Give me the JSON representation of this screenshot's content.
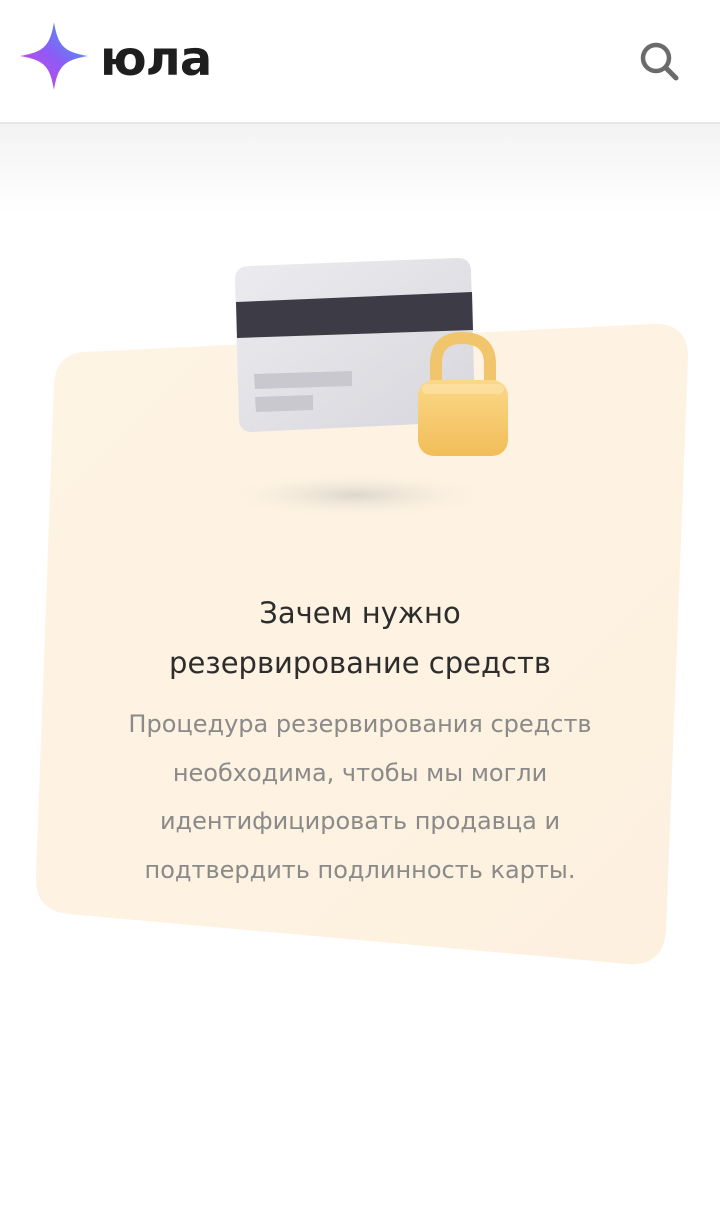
{
  "header": {
    "logo_text": "юла",
    "logo_icon": "star-logo-icon",
    "search_icon": "search-icon"
  },
  "info_card": {
    "illustration_icons": [
      "credit-card-icon",
      "padlock-icon"
    ],
    "title_lines": [
      "Зачем нужно",
      "резервирование средств"
    ],
    "description_lines": [
      "Процедура резервирования средств",
      "необходима, чтобы мы могли",
      "идентифицировать продавца и",
      "подтвердить подлинность карты."
    ]
  },
  "colors": {
    "card_background": "#fdf1e0",
    "title_text": "#2d2d2d",
    "body_text": "#8a8a8a",
    "card_stripe": "#3d3b45",
    "lock_body": "#f6c76a",
    "logo_gradient_start": "#c040e8",
    "logo_gradient_end": "#32a2f2"
  }
}
